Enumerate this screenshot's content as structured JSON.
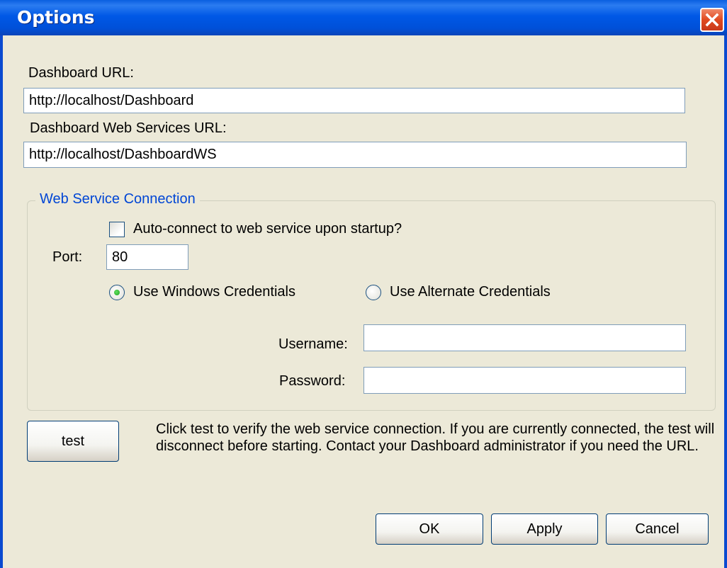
{
  "window": {
    "title": "Options",
    "close_icon": "close-icon"
  },
  "dashboard_url": {
    "label": "Dashboard URL:",
    "value": "http://localhost/Dashboard"
  },
  "webservices_url": {
    "label": "Dashboard Web Services URL:",
    "value": "http://localhost/DashboardWS"
  },
  "connection_group": {
    "legend": "Web Service Connection",
    "autoconnect_label": "Auto-connect to web service upon startup?",
    "autoconnect_checked": false,
    "port_label": "Port:",
    "port_value": "80",
    "radio_windows_label": "Use Windows Credentials",
    "radio_alternate_label": "Use Alternate Credentials",
    "selected_credentials": "windows",
    "username_label": "Username:",
    "username_value": "",
    "password_label": "Password:",
    "password_value": ""
  },
  "test": {
    "button_label": "test",
    "description": "Click test to verify the web service connection. If you are currently connected, the test will disconnect before starting. Contact your Dashboard administrator if you need the URL."
  },
  "footer": {
    "ok_label": "OK",
    "apply_label": "Apply",
    "cancel_label": "Cancel"
  },
  "colors": {
    "titlebar": "#0058e6",
    "dialog_bg": "#ece9d8",
    "group_legend": "#0046d5",
    "close_button": "#e04a20"
  }
}
